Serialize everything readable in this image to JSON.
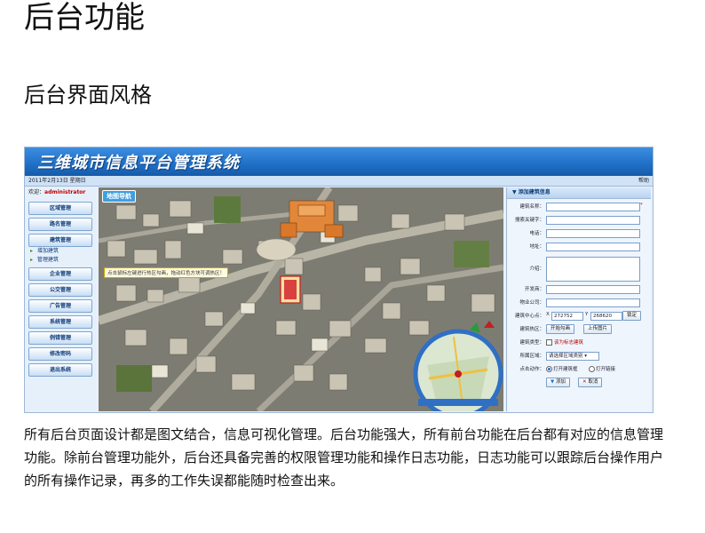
{
  "heading": "后台功能",
  "subheading": "后台界面风格",
  "paragraph": "所有后台页面设计都是图文结合，信息可视化管理。后台功能强大，所有前台功能在后台都有对应的信息管理功能。除前台管理功能外，后台还具备完善的权限管理功能和操作日志功能，日志功能可以跟踪后台操作用户的所有操作记录，再多的工作失误都能随时检查出来。",
  "screenshot": {
    "system_title": "三维城市信息平台管理系统",
    "date": "2011年2月13日 星期日",
    "help": "帮助",
    "welcome_prefix": "欢迎：",
    "welcome_user": "administrator",
    "menu": {
      "items_top": [
        "区域管理",
        "路名管理",
        "建筑管理"
      ],
      "sub_items": [
        "增加建筑",
        "管理建筑"
      ],
      "items_bottom": [
        "企业管理",
        "公交管理",
        "广告管理",
        "系统管理",
        "例错管理",
        "修改密码",
        "退出系统"
      ]
    },
    "map_nav": "地图导航",
    "map_tip": "点击鼠标左键进行热区勾画，拖动红色方块可调热区！",
    "form": {
      "title": "添加建筑信息",
      "labels": [
        "建筑名称：",
        "搜索关键字：",
        "电话：",
        "地址：",
        "介绍：",
        "开发商：",
        "物业公司：",
        "建筑中心点：",
        "建筑热区：",
        "建筑类型：",
        "所属区域：",
        "点击动作："
      ],
      "center_x_label": "X",
      "center_x": "272752",
      "center_y_label": "Y",
      "center_y": "268620",
      "locate_btn": "锁定",
      "hotspot_btn1": "开始勾画",
      "hotspot_btn2": "上传图片",
      "type_checkbox": "该为标志建筑",
      "region_select": "请选择区域类别",
      "action_opt1": "打开建筑框",
      "action_opt2": "打开链接",
      "add_btn": "添加",
      "cancel_btn": "取消"
    }
  }
}
